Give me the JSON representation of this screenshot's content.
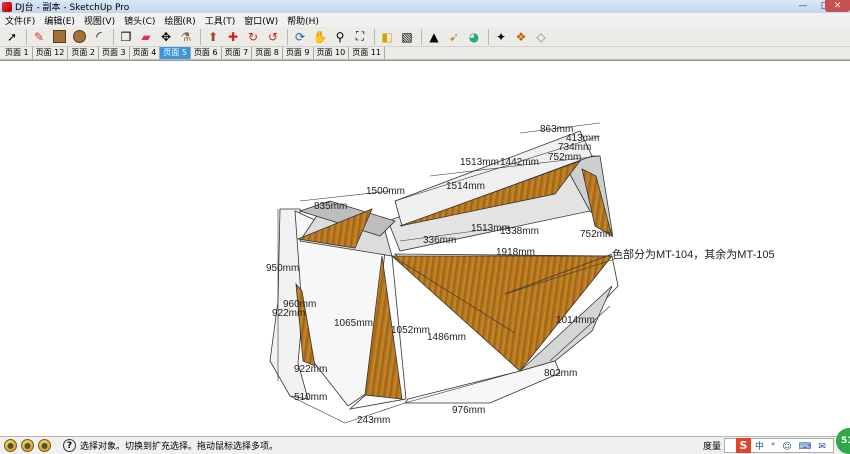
{
  "window": {
    "title": "DJ台 - 副本 - SketchUp Pro"
  },
  "menu": [
    "文件(F)",
    "编辑(E)",
    "视图(V)",
    "镜头(C)",
    "绘图(R)",
    "工具(T)",
    "窗口(W)",
    "帮助(H)"
  ],
  "tabs": [
    "页面 1",
    "页面 12",
    "页面 2",
    "页面 3",
    "页面 4",
    "页面 5",
    "页面 6",
    "页面 7",
    "页面 8",
    "页面 9",
    "页面 10",
    "页面 11"
  ],
  "active_tab": "页面 5",
  "dimensions": {
    "d863": "863mm",
    "d413": "413mm",
    "d734": "734mm",
    "d752": "752mm",
    "d1442": "1442mm",
    "d1513a": "1513mm",
    "d1514": "1514mm",
    "d1500": "1500mm",
    "d835": "835mm",
    "d336": "336mm",
    "d1513b": "1513mm",
    "d1338": "1338mm",
    "d1918": "1918mm",
    "d752b": "752mm",
    "d950": "950mm",
    "d960": "960mm",
    "d922": "922mm",
    "d1065": "1065mm",
    "d1052": "1052mm",
    "d1486": "1486mm",
    "d1014": "1014mm",
    "d802": "802mm",
    "d922b": "922mm",
    "d510": "510mm",
    "d243": "243mm",
    "d976": "976mm"
  },
  "note": "色部分为MT-104，其余为MT-105",
  "status": {
    "message": "选择对象。切换到扩充选择。拖动鼠标选择多项。",
    "measure_label": "度量",
    "ime_text": "中 ° ☺ ⌨ ✉",
    "badge": "51"
  }
}
